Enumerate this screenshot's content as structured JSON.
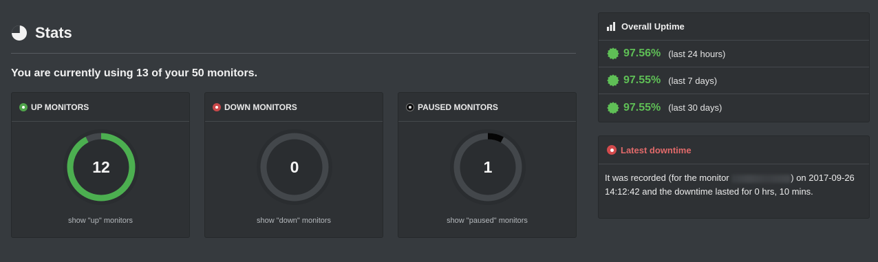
{
  "header": {
    "title": "Stats",
    "usage_text": "You are currently using 13 of your 50 monitors."
  },
  "monitors": [
    {
      "status": "up",
      "label": "UP MONITORS",
      "count": "12",
      "count_value": 12,
      "total": 13,
      "ring_color": "#4caf50",
      "link": "show \"up\" monitors"
    },
    {
      "status": "down",
      "label": "DOWN MONITORS",
      "count": "0",
      "count_value": 0,
      "total": 13,
      "ring_color": "#c9484a",
      "link": "show \"down\" monitors"
    },
    {
      "status": "paused",
      "label": "PAUSED MONITORS",
      "count": "1",
      "count_value": 1,
      "total": 13,
      "ring_color": "#050505",
      "link": "show \"paused\" monitors"
    }
  ],
  "uptime": {
    "title": "Overall Uptime",
    "rows": [
      {
        "pct": "97.56%",
        "period": "(last 24 hours)"
      },
      {
        "pct": "97.55%",
        "period": "(last 7 days)"
      },
      {
        "pct": "97.55%",
        "period": "(last 30 days)"
      }
    ]
  },
  "downtime": {
    "title": "Latest downtime",
    "text_before": "It was recorded (for the monitor",
    "text_after": ") on 2017-09-26 14:12:42 and the downtime lasted for 0 hrs, 10 mins."
  },
  "colors": {
    "background": "#363a3e",
    "panel": "#2e3134",
    "success": "#5fbf56",
    "danger": "#e16a6a",
    "ring_track": "#43474b"
  },
  "icons": {
    "stats": "pie-chart-icon",
    "uptime": "bar-chart-icon",
    "uptime_badge": "seal-badge-icon",
    "downtime": "record-dot-icon"
  }
}
